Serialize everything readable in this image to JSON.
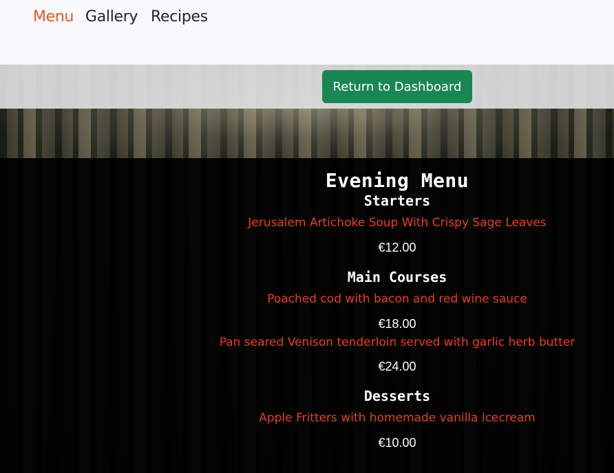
{
  "nav": {
    "items": [
      {
        "label": "Menu",
        "active": true
      },
      {
        "label": "Gallery",
        "active": false
      },
      {
        "label": "Recipes",
        "active": false
      }
    ]
  },
  "dashboard": {
    "button_label": "Return to Dashboard",
    "button_color": "#198754"
  },
  "menu": {
    "title": "Evening Menu",
    "sections": [
      {
        "title": "Starters",
        "items": [
          {
            "name": "Jerusalem Artichoke Soup With Crispy Sage Leaves",
            "price": "€12.00"
          }
        ]
      },
      {
        "title": "Main Courses",
        "items": [
          {
            "name": "Poached cod with bacon and red wine sauce",
            "price": "€18.00"
          },
          {
            "name": "Pan seared Venison tenderloin served with garlic herb butter",
            "price": "€24.00"
          }
        ]
      },
      {
        "title": "Desserts",
        "items": [
          {
            "name": "Apple Fritters with homemade vanilla icecream",
            "price": "€10.00"
          }
        ]
      }
    ]
  },
  "colors": {
    "accent": "#e8562f",
    "dish_text": "#e8401c",
    "panel_bg": "#000000"
  }
}
